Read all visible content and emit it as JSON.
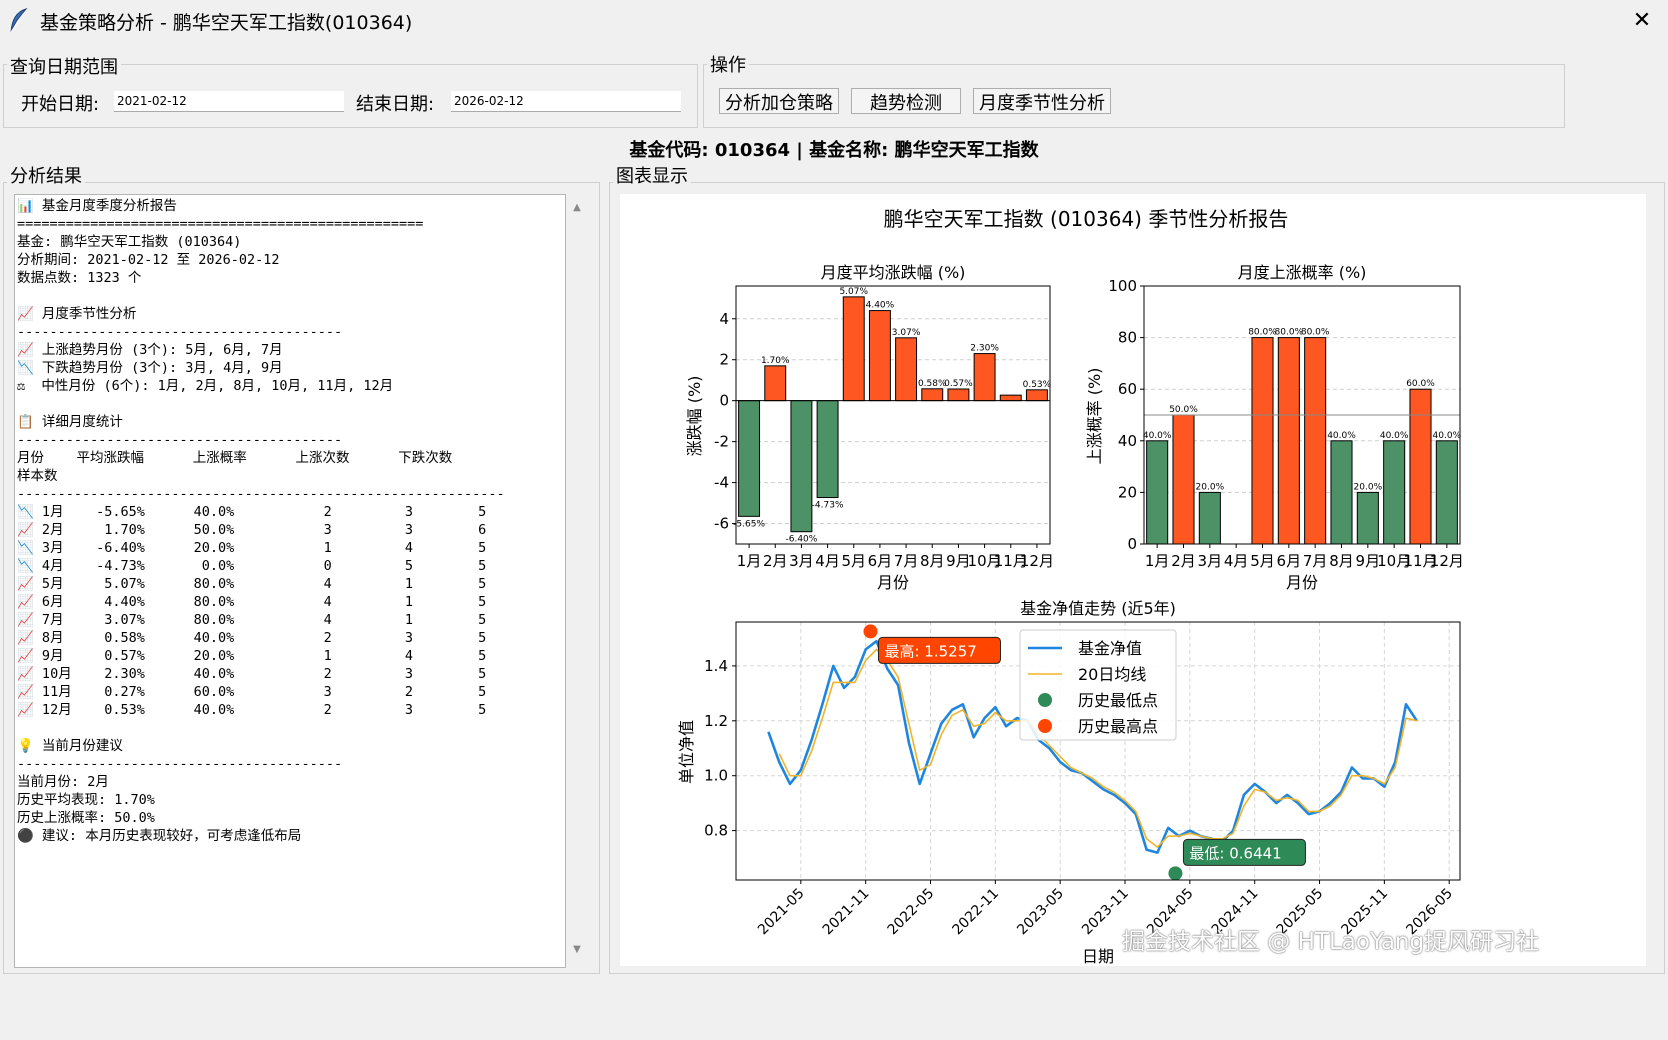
{
  "window": {
    "title": "基金策略分析 - 鹏华空天军工指数(010364)",
    "close_glyph": "✕"
  },
  "date_range": {
    "group_label": "查询日期范围",
    "start_label": "开始日期:",
    "start_value": "2021-02-12",
    "end_label": "结束日期:",
    "end_value": "2026-02-12"
  },
  "operations": {
    "group_label": "操作",
    "buttons": [
      "分析加仓策略",
      "趋势检测",
      "月度季节性分析"
    ]
  },
  "fund_header": "基金代码: 010364 | 基金名称: 鹏华空天军工指数",
  "results_label": "分析结果",
  "chart_panel_label": "图表显示",
  "report_lines": [
    "📊 基金月度季度分析报告",
    "==================================================",
    "基金: 鹏华空天军工指数 (010364)",
    "分析期间: 2021-02-12 至 2026-02-12",
    "数据点数: 1323 个",
    "",
    "📈 月度季节性分析",
    "----------------------------------------",
    "📈 上涨趋势月份 (3个): 5月, 6月, 7月",
    "📉 下跌趋势月份 (3个): 3月, 4月, 9月",
    "⚖  中性月份 (6个): 1月, 2月, 8月, 10月, 11月, 12月",
    "",
    "📋 详细月度统计",
    "----------------------------------------",
    "月份    平均涨跌幅      上涨概率      上涨次数      下跌次数",
    "样本数",
    "------------------------------------------------------------",
    "📉 1月    -5.65%      40.0%           2         3        5",
    "📈 2月     1.70%      50.0%           3         3        6",
    "📉 3月    -6.40%      20.0%           1         4        5",
    "📉 4月    -4.73%       0.0%           0         5        5",
    "📈 5月     5.07%      80.0%           4         1        5",
    "📈 6月     4.40%      80.0%           4         1        5",
    "📈 7月     3.07%      80.0%           4         1        5",
    "📈 8月     0.58%      40.0%           2         3        5",
    "📈 9月     0.57%      20.0%           1         4        5",
    "📈 10月    2.30%      40.0%           2         3        5",
    "📈 11月    0.27%      60.0%           3         2        5",
    "📈 12月    0.53%      40.0%           2         3        5",
    "",
    "💡 当前月份建议",
    "----------------------------------------",
    "当前月份: 2月",
    "历史平均表现: 1.70%",
    "历史上涨概率: 50.0%",
    "⚫ 建议: 本月历史表现较好，可考虑逢低布局"
  ],
  "chart_data": [
    {
      "type": "bar",
      "title": "月度平均涨跌幅 (%)",
      "xlabel": "月份",
      "ylabel": "涨跌幅 (%)",
      "categories": [
        "1月",
        "2月",
        "3月",
        "4月",
        "5月",
        "6月",
        "7月",
        "8月",
        "9月",
        "10月",
        "11月",
        "12月"
      ],
      "values": [
        -5.65,
        1.7,
        -6.4,
        -4.73,
        5.07,
        4.4,
        3.07,
        0.58,
        0.57,
        2.3,
        0.27,
        0.53
      ],
      "data_labels": [
        "-5.65%",
        "1.70%",
        "-6.40%",
        "-4.73%",
        "5.07%",
        "4.40%",
        "3.07%",
        "0.58%",
        "0.57%",
        "2.30%",
        "",
        "0.53%"
      ],
      "ylim": [
        -7,
        5.6
      ],
      "yticks": [
        -6,
        -4,
        -2,
        0,
        2,
        4
      ],
      "grid": true,
      "colors": {
        "positive": "#ff5722",
        "negative": "#4d9166"
      }
    },
    {
      "type": "bar",
      "title": "月度上涨概率 (%)",
      "xlabel": "月份",
      "ylabel": "上涨概率 (%)",
      "categories": [
        "1月",
        "2月",
        "3月",
        "4月",
        "5月",
        "6月",
        "7月",
        "8月",
        "9月",
        "10月",
        "11月",
        "12月"
      ],
      "values": [
        40,
        50,
        20,
        0,
        80,
        80,
        80,
        40,
        20,
        40,
        60,
        40
      ],
      "data_labels": [
        "40.0%",
        "50.0%",
        "20.0%",
        "",
        "80.0%",
        "80.0%",
        "80.0%",
        "40.0%",
        "20.0%",
        "40.0%",
        "60.0%",
        "40.0%"
      ],
      "ylim": [
        0,
        100
      ],
      "yticks": [
        0,
        20,
        40,
        60,
        80,
        100
      ],
      "reference_line": 50,
      "grid": true,
      "colors": {
        "above": "#ff5722",
        "below": "#4d9166"
      }
    },
    {
      "type": "line",
      "title": "基金净值走势 (近5年)",
      "xlabel": "日期",
      "ylabel": "单位净值",
      "xticks": [
        "2021-05",
        "2021-11",
        "2022-05",
        "2022-11",
        "2023-05",
        "2023-11",
        "2024-05",
        "2024-11",
        "2025-05",
        "2025-11",
        "2026-05"
      ],
      "ylim": [
        0.62,
        1.56
      ],
      "yticks": [
        0.8,
        1.0,
        1.2,
        1.4
      ],
      "grid": true,
      "legend_placement": "top-center",
      "series": [
        {
          "name": "基金净值",
          "color": "#1f86e0",
          "points": [
            [
              "2021-02",
              1.16
            ],
            [
              "2021-03",
              1.05
            ],
            [
              "2021-04",
              0.97
            ],
            [
              "2021-05",
              1.02
            ],
            [
              "2021-06",
              1.13
            ],
            [
              "2021-07",
              1.26
            ],
            [
              "2021-08",
              1.4
            ],
            [
              "2021-09",
              1.32
            ],
            [
              "2021-10",
              1.36
            ],
            [
              "2021-11",
              1.46
            ],
            [
              "2021-12",
              1.49
            ],
            [
              "2022-01",
              1.39
            ],
            [
              "2022-02",
              1.33
            ],
            [
              "2022-03",
              1.12
            ],
            [
              "2022-04",
              0.97
            ],
            [
              "2022-05",
              1.08
            ],
            [
              "2022-06",
              1.19
            ],
            [
              "2022-07",
              1.24
            ],
            [
              "2022-08",
              1.26
            ],
            [
              "2022-09",
              1.14
            ],
            [
              "2022-10",
              1.21
            ],
            [
              "2022-11",
              1.25
            ],
            [
              "2022-12",
              1.18
            ],
            [
              "2023-01",
              1.21
            ],
            [
              "2023-02",
              1.2
            ],
            [
              "2023-03",
              1.13
            ],
            [
              "2023-04",
              1.1
            ],
            [
              "2023-05",
              1.05
            ],
            [
              "2023-06",
              1.02
            ],
            [
              "2023-07",
              1.01
            ],
            [
              "2023-08",
              0.98
            ],
            [
              "2023-09",
              0.95
            ],
            [
              "2023-10",
              0.93
            ],
            [
              "2023-11",
              0.9
            ],
            [
              "2023-12",
              0.86
            ],
            [
              "2024-01",
              0.73
            ],
            [
              "2024-02",
              0.72
            ],
            [
              "2024-03",
              0.81
            ],
            [
              "2024-04",
              0.78
            ],
            [
              "2024-05",
              0.8
            ],
            [
              "2024-06",
              0.78
            ],
            [
              "2024-07",
              0.77
            ],
            [
              "2024-08",
              0.76
            ],
            [
              "2024-09",
              0.8
            ],
            [
              "2024-10",
              0.93
            ],
            [
              "2024-11",
              0.97
            ],
            [
              "2024-12",
              0.94
            ],
            [
              "2025-01",
              0.9
            ],
            [
              "2025-02",
              0.93
            ],
            [
              "2025-03",
              0.9
            ],
            [
              "2025-04",
              0.86
            ],
            [
              "2025-05",
              0.87
            ],
            [
              "2025-06",
              0.9
            ],
            [
              "2025-07",
              0.94
            ],
            [
              "2025-08",
              1.03
            ],
            [
              "2025-09",
              0.99
            ],
            [
              "2025-10",
              0.99
            ],
            [
              "2025-11",
              0.96
            ],
            [
              "2025-12",
              1.05
            ],
            [
              "2026-01",
              1.26
            ],
            [
              "2026-02",
              1.2
            ]
          ]
        },
        {
          "name": "20日均线",
          "color": "#f0b429",
          "points": [
            [
              "2021-03",
              1.08
            ],
            [
              "2021-04",
              1.0
            ],
            [
              "2021-05",
              1.0
            ],
            [
              "2021-06",
              1.09
            ],
            [
              "2021-07",
              1.21
            ],
            [
              "2021-08",
              1.34
            ],
            [
              "2021-09",
              1.34
            ],
            [
              "2021-10",
              1.34
            ],
            [
              "2021-11",
              1.42
            ],
            [
              "2021-12",
              1.46
            ],
            [
              "2022-01",
              1.42
            ],
            [
              "2022-02",
              1.36
            ],
            [
              "2022-03",
              1.19
            ],
            [
              "2022-04",
              1.02
            ],
            [
              "2022-05",
              1.04
            ],
            [
              "2022-06",
              1.15
            ],
            [
              "2022-07",
              1.22
            ],
            [
              "2022-08",
              1.24
            ],
            [
              "2022-09",
              1.18
            ],
            [
              "2022-10",
              1.19
            ],
            [
              "2022-11",
              1.23
            ],
            [
              "2022-12",
              1.2
            ],
            [
              "2023-01",
              1.2
            ],
            [
              "2023-02",
              1.2
            ],
            [
              "2023-03",
              1.15
            ],
            [
              "2023-04",
              1.11
            ],
            [
              "2023-05",
              1.07
            ],
            [
              "2023-06",
              1.03
            ],
            [
              "2023-07",
              1.01
            ],
            [
              "2023-08",
              0.99
            ],
            [
              "2023-09",
              0.96
            ],
            [
              "2023-10",
              0.94
            ],
            [
              "2023-11",
              0.91
            ],
            [
              "2023-12",
              0.87
            ],
            [
              "2024-01",
              0.77
            ],
            [
              "2024-02",
              0.74
            ],
            [
              "2024-03",
              0.78
            ],
            [
              "2024-04",
              0.78
            ],
            [
              "2024-05",
              0.79
            ],
            [
              "2024-06",
              0.78
            ],
            [
              "2024-07",
              0.77
            ],
            [
              "2024-08",
              0.77
            ],
            [
              "2024-09",
              0.79
            ],
            [
              "2024-10",
              0.89
            ],
            [
              "2024-11",
              0.95
            ],
            [
              "2024-12",
              0.94
            ],
            [
              "2025-01",
              0.91
            ],
            [
              "2025-02",
              0.92
            ],
            [
              "2025-03",
              0.91
            ],
            [
              "2025-04",
              0.87
            ],
            [
              "2025-05",
              0.87
            ],
            [
              "2025-06",
              0.89
            ],
            [
              "2025-07",
              0.93
            ],
            [
              "2025-08",
              1.0
            ],
            [
              "2025-09",
              1.0
            ],
            [
              "2025-10",
              0.99
            ],
            [
              "2025-11",
              0.97
            ],
            [
              "2025-12",
              1.03
            ],
            [
              "2026-01",
              1.21
            ],
            [
              "2026-02",
              1.2
            ]
          ]
        }
      ],
      "extremes": {
        "low": {
          "legend": "历史最低点",
          "date": "2024-02",
          "value": 0.6441,
          "label": "最低: 0.6441",
          "color": "#2e8b57"
        },
        "high": {
          "legend": "历史最高点",
          "date": "2021-12",
          "value": 1.5257,
          "label": "最高: 1.5257",
          "color": "#ff4500"
        }
      }
    }
  ],
  "suptitle": "鹏华空天军工指数 (010364) 季节性分析报告",
  "watermark": "掘金技术社区 @ HTLaoYang捉风研习社",
  "icons": {
    "app": "feather-icon",
    "scroll_up": "scroll-up-icon",
    "scroll_down": "scroll-down-icon"
  }
}
